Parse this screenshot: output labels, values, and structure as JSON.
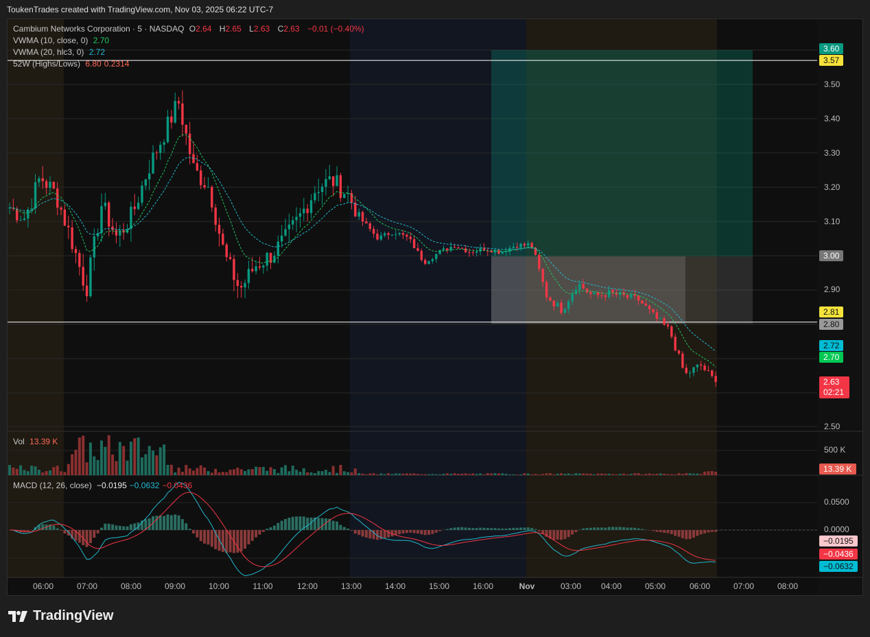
{
  "caption": "ToukenTrades created with TradingView.com, Nov 03, 2025 06:22 UTC-7",
  "legend": {
    "symbol": "Cambium Networks Corporation · 5 · NASDAQ",
    "o_label": "O",
    "o": "2.64",
    "h_label": "H",
    "h": "2.65",
    "l_label": "L",
    "l": "2.63",
    "c_label": "C",
    "c": "2.63",
    "change": "−0.01 (−0.40%)",
    "vwma10": "VWMA (10, close, 0)",
    "vwma10_val": "2.70",
    "vwma20": "VWMA (20, hlc3, 0)",
    "vwma20_val": "2.72",
    "w52": "52W (Highs/Lows)",
    "w52_high": "6.80",
    "w52_low": "0.2314",
    "vol": "Vol",
    "vol_val": "13.39 K",
    "macd": "MACD (12, 26, close)",
    "macd_hist": "−0.0195",
    "macd_line": "−0.0632",
    "macd_signal": "−0.0436"
  },
  "price_axis": [
    "3.50",
    "3.40",
    "3.30",
    "3.20",
    "3.10",
    "2.90",
    "2.50"
  ],
  "price_tags": {
    "tp": "3.60",
    "high52": "3.57",
    "entry": "3.00",
    "line281": "2.81",
    "stop": "2.80",
    "vwma20": "2.72",
    "vwma10": "2.70",
    "last": "2.63",
    "countdown": "02:21"
  },
  "vol_axis": "500 K",
  "vol_tag": "13.39 K",
  "macd_axis": [
    "0.0500",
    "0.0000"
  ],
  "macd_tags": {
    "hist": "−0.0195",
    "signal": "−0.0436",
    "macd": "−0.0632"
  },
  "time_axis": [
    "06:00",
    "07:00",
    "08:00",
    "09:00",
    "10:00",
    "11:00",
    "12:00",
    "13:00",
    "14:00",
    "15:00",
    "16:00",
    "Nov",
    "03:00",
    "04:00",
    "05:00",
    "06:00",
    "07:00",
    "08:00"
  ],
  "brand": "TradingView",
  "colors": {
    "up": "#089981",
    "down": "#f23645",
    "vwma10": "#22c55e",
    "vwma20": "#22b8cf",
    "macd": "#22b8cf",
    "signal": "#f23645"
  },
  "chart_data": {
    "type": "candlestick",
    "ylim": [
      2.45,
      3.65
    ],
    "anchor_closes": [
      3.14,
      3.11,
      3.23,
      3.18,
      3.05,
      2.9,
      3.15,
      3.05,
      3.12,
      3.25,
      3.35,
      3.45,
      3.25,
      3.2,
      3.0,
      2.9,
      2.97,
      3.0,
      3.05,
      3.12,
      3.2,
      3.22,
      3.18,
      3.1,
      3.05,
      3.07,
      3.05,
      2.98,
      3.01,
      3.03,
      3.01,
      3.02,
      3.01,
      3.03,
      3.03,
      2.88,
      2.84,
      2.92,
      2.88,
      2.89,
      2.88,
      2.87,
      2.82,
      2.78,
      2.65,
      2.68,
      2.63
    ]
  }
}
